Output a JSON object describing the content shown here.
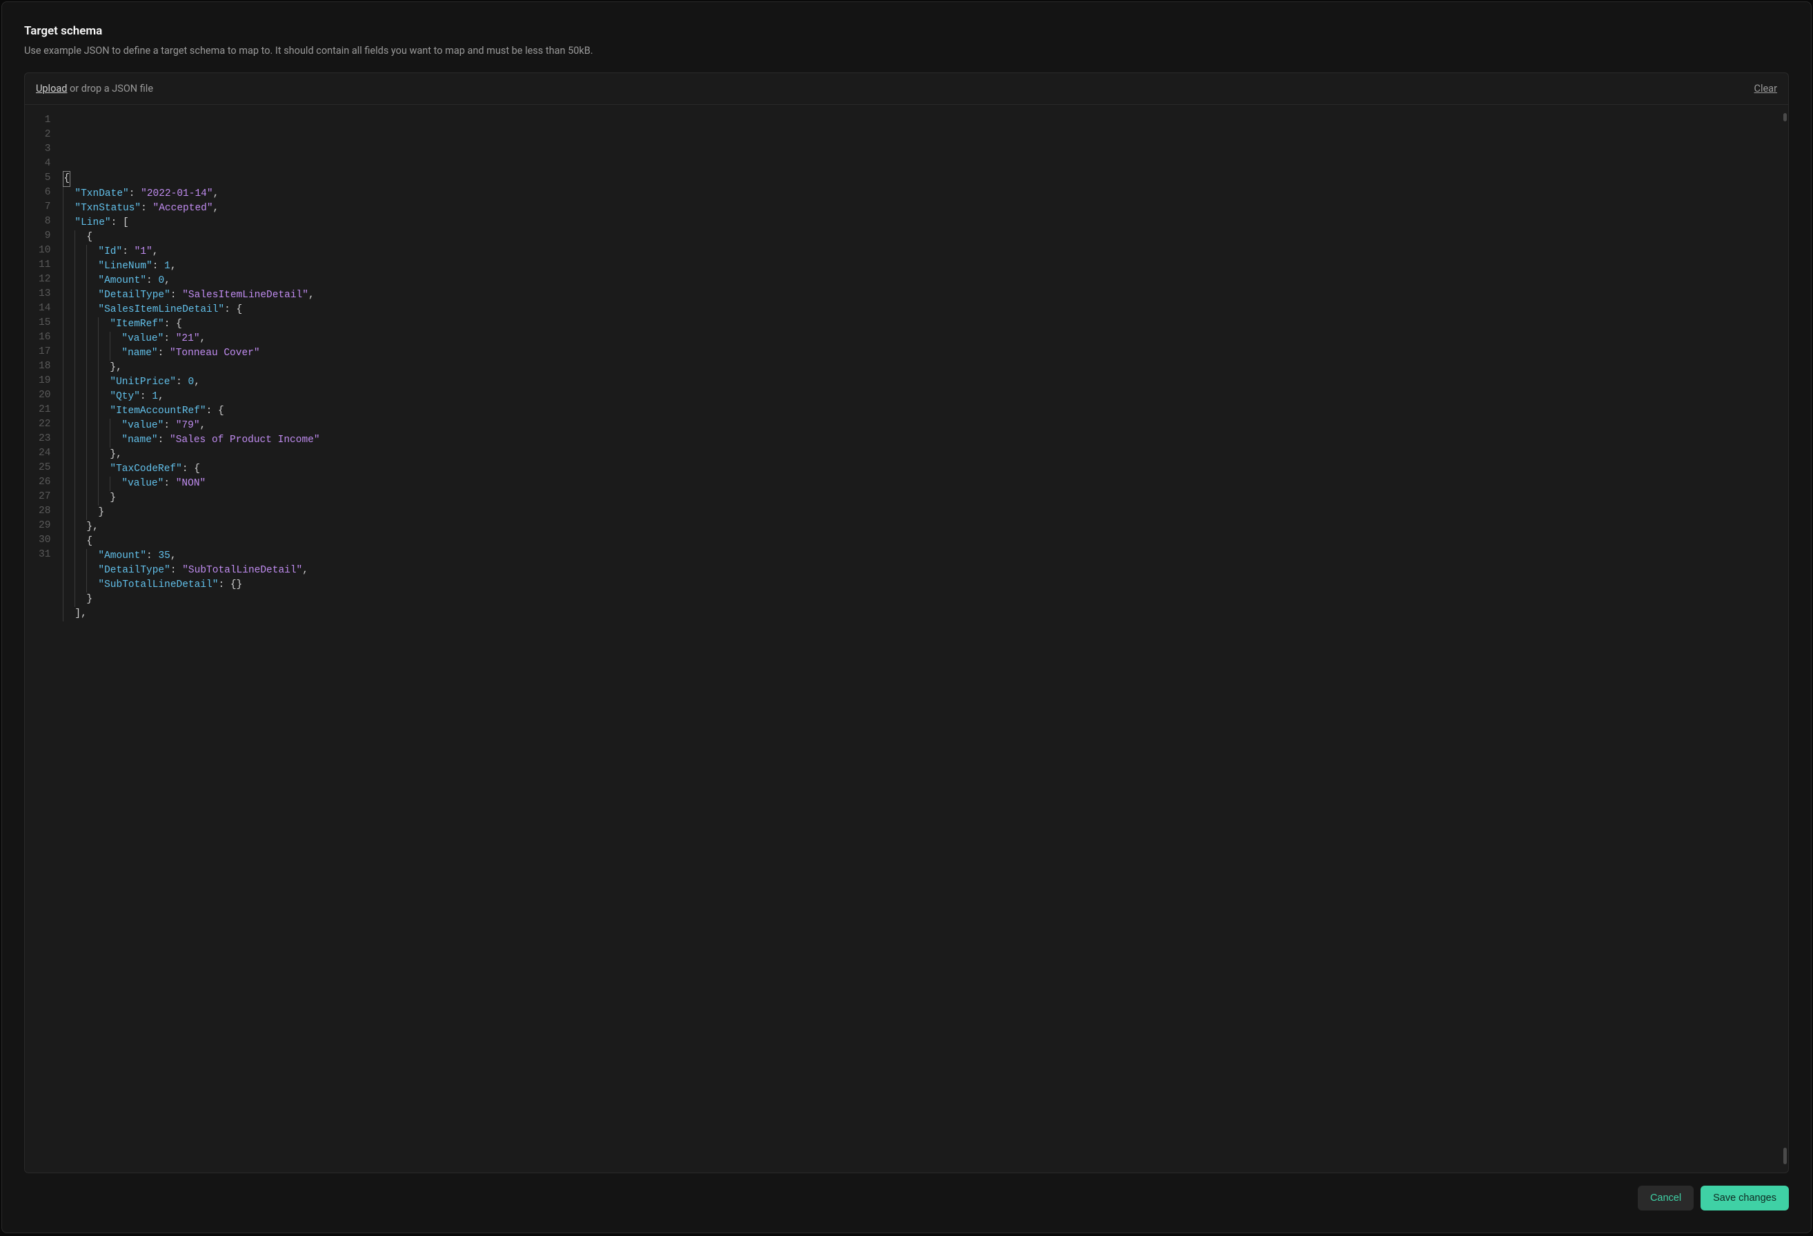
{
  "header": {
    "title": "Target schema",
    "subtitle": "Use example JSON to define a target schema to map to. It should contain all fields you want to map and must be less than 50kB."
  },
  "uploadBar": {
    "uploadLink": "Upload",
    "dropText": " or drop a JSON file",
    "clearLink": "Clear"
  },
  "editor": {
    "lineCount": 31,
    "lines": [
      [
        {
          "t": "cursor",
          "v": "{"
        }
      ],
      [
        {
          "t": "key",
          "v": "\"TxnDate\""
        },
        {
          "t": "punct",
          "v": ": "
        },
        {
          "t": "str",
          "v": "\"2022-01-14\""
        },
        {
          "t": "punct",
          "v": ","
        }
      ],
      [
        {
          "t": "key",
          "v": "\"TxnStatus\""
        },
        {
          "t": "punct",
          "v": ": "
        },
        {
          "t": "str",
          "v": "\"Accepted\""
        },
        {
          "t": "punct",
          "v": ","
        }
      ],
      [
        {
          "t": "key",
          "v": "\"Line\""
        },
        {
          "t": "punct",
          "v": ": ["
        }
      ],
      [
        {
          "t": "punct",
          "v": "{"
        }
      ],
      [
        {
          "t": "key",
          "v": "\"Id\""
        },
        {
          "t": "punct",
          "v": ": "
        },
        {
          "t": "str",
          "v": "\"1\""
        },
        {
          "t": "punct",
          "v": ","
        }
      ],
      [
        {
          "t": "key",
          "v": "\"LineNum\""
        },
        {
          "t": "punct",
          "v": ": "
        },
        {
          "t": "num",
          "v": "1"
        },
        {
          "t": "punct",
          "v": ","
        }
      ],
      [
        {
          "t": "key",
          "v": "\"Amount\""
        },
        {
          "t": "punct",
          "v": ": "
        },
        {
          "t": "num",
          "v": "0"
        },
        {
          "t": "punct",
          "v": ","
        }
      ],
      [
        {
          "t": "key",
          "v": "\"DetailType\""
        },
        {
          "t": "punct",
          "v": ": "
        },
        {
          "t": "str",
          "v": "\"SalesItemLineDetail\""
        },
        {
          "t": "punct",
          "v": ","
        }
      ],
      [
        {
          "t": "key",
          "v": "\"SalesItemLineDetail\""
        },
        {
          "t": "punct",
          "v": ": {"
        }
      ],
      [
        {
          "t": "key",
          "v": "\"ItemRef\""
        },
        {
          "t": "punct",
          "v": ": {"
        }
      ],
      [
        {
          "t": "key",
          "v": "\"value\""
        },
        {
          "t": "punct",
          "v": ": "
        },
        {
          "t": "str",
          "v": "\"21\""
        },
        {
          "t": "punct",
          "v": ","
        }
      ],
      [
        {
          "t": "key",
          "v": "\"name\""
        },
        {
          "t": "punct",
          "v": ": "
        },
        {
          "t": "str",
          "v": "\"Tonneau Cover\""
        }
      ],
      [
        {
          "t": "punct",
          "v": "},"
        }
      ],
      [
        {
          "t": "key",
          "v": "\"UnitPrice\""
        },
        {
          "t": "punct",
          "v": ": "
        },
        {
          "t": "num",
          "v": "0"
        },
        {
          "t": "punct",
          "v": ","
        }
      ],
      [
        {
          "t": "key",
          "v": "\"Qty\""
        },
        {
          "t": "punct",
          "v": ": "
        },
        {
          "t": "num",
          "v": "1"
        },
        {
          "t": "punct",
          "v": ","
        }
      ],
      [
        {
          "t": "key",
          "v": "\"ItemAccountRef\""
        },
        {
          "t": "punct",
          "v": ": {"
        }
      ],
      [
        {
          "t": "key",
          "v": "\"value\""
        },
        {
          "t": "punct",
          "v": ": "
        },
        {
          "t": "str",
          "v": "\"79\""
        },
        {
          "t": "punct",
          "v": ","
        }
      ],
      [
        {
          "t": "key",
          "v": "\"name\""
        },
        {
          "t": "punct",
          "v": ": "
        },
        {
          "t": "str",
          "v": "\"Sales of Product Income\""
        }
      ],
      [
        {
          "t": "punct",
          "v": "},"
        }
      ],
      [
        {
          "t": "key",
          "v": "\"TaxCodeRef\""
        },
        {
          "t": "punct",
          "v": ": {"
        }
      ],
      [
        {
          "t": "key",
          "v": "\"value\""
        },
        {
          "t": "punct",
          "v": ": "
        },
        {
          "t": "str",
          "v": "\"NON\""
        }
      ],
      [
        {
          "t": "punct",
          "v": "}"
        }
      ],
      [
        {
          "t": "punct",
          "v": "}"
        }
      ],
      [
        {
          "t": "punct",
          "v": "},"
        }
      ],
      [
        {
          "t": "punct",
          "v": "{"
        }
      ],
      [
        {
          "t": "key",
          "v": "\"Amount\""
        },
        {
          "t": "punct",
          "v": ": "
        },
        {
          "t": "num",
          "v": "35"
        },
        {
          "t": "punct",
          "v": ","
        }
      ],
      [
        {
          "t": "key",
          "v": "\"DetailType\""
        },
        {
          "t": "punct",
          "v": ": "
        },
        {
          "t": "str",
          "v": "\"SubTotalLineDetail\""
        },
        {
          "t": "punct",
          "v": ","
        }
      ],
      [
        {
          "t": "key",
          "v": "\"SubTotalLineDetail\""
        },
        {
          "t": "punct",
          "v": ": {}"
        }
      ],
      [
        {
          "t": "punct",
          "v": "}"
        }
      ],
      [
        {
          "t": "punct",
          "v": "],"
        }
      ]
    ],
    "indents": [
      0,
      1,
      1,
      1,
      2,
      3,
      3,
      3,
      3,
      3,
      4,
      5,
      5,
      4,
      4,
      4,
      4,
      5,
      5,
      4,
      4,
      5,
      4,
      3,
      2,
      2,
      3,
      3,
      3,
      2,
      1
    ]
  },
  "footer": {
    "cancel": "Cancel",
    "save": "Save changes"
  },
  "colors": {
    "accent": "#3fd1a5",
    "key": "#62c0ea",
    "string": "#c08cf0"
  }
}
